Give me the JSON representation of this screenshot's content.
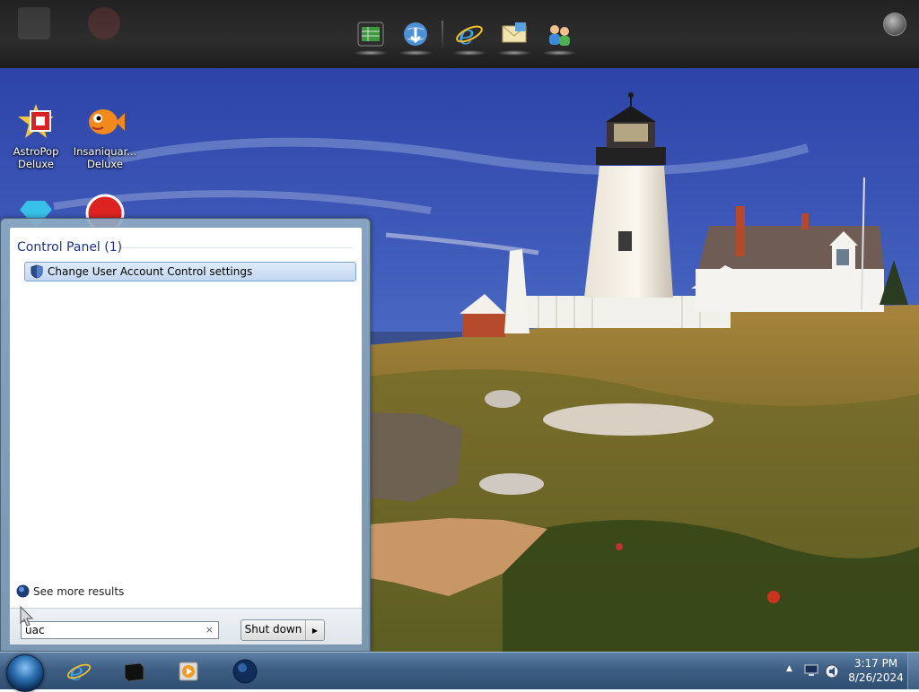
{
  "desktop": {
    "icons": [
      {
        "label_line1": "AstroPop",
        "label_line2": "Deluxe",
        "icon": "astropop-icon"
      },
      {
        "label_line1": "Insaniquar...",
        "label_line2": "Deluxe",
        "icon": "fish-icon"
      }
    ]
  },
  "dock": {
    "items": [
      "spreadsheet-icon",
      "globe-download-icon",
      "internet-explorer-icon",
      "mail-icon",
      "people-icon"
    ]
  },
  "start_menu": {
    "section_header": "Control Panel (1)",
    "result_label": "Change User Account Control settings",
    "see_more": "See more results",
    "search_value": "uac",
    "search_clear": "×",
    "shutdown_label": "Shut down",
    "shutdown_arrow": "▶"
  },
  "taskbar": {
    "items": [
      "internet-explorer-icon",
      "dark-tile-icon",
      "media-player-icon",
      "globe-icon"
    ],
    "tray": {
      "expand_glyph": "▲"
    },
    "clock": {
      "time": "3:17 PM",
      "date": "8/26/2024"
    }
  },
  "colors": {
    "taskbar": "#3e5f83",
    "section_header": "#1e3287",
    "highlight_border": "#7da2ce"
  }
}
